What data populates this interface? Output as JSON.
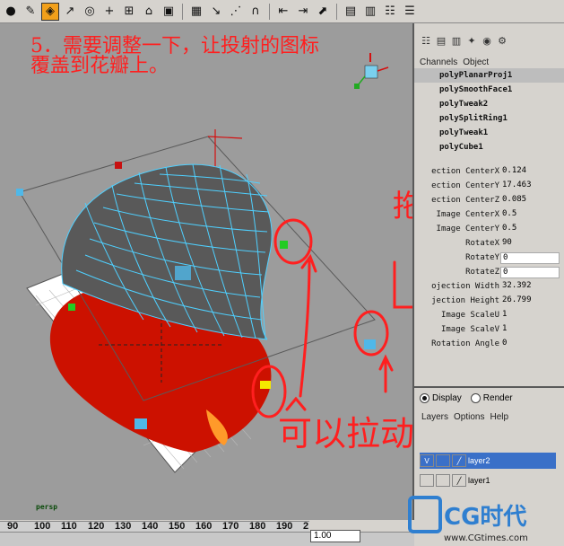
{
  "toolbar": {
    "icons": [
      "select-tool-icon",
      "lasso-tool-icon",
      "paint-select-icon",
      "curve-tool-icon",
      "target-icon",
      "plus-icon",
      "grid-icon",
      "lock-icon",
      "magnet-icon",
      "render-icon",
      "mesh-icon",
      "snap-curve-icon",
      "snap-point-icon",
      "snap-plane-icon",
      "history-icon",
      "frame-icon",
      "ipr-icon",
      "film-icon",
      "channel-box-icon",
      "attribute-editor-icon",
      "tool-settings-icon"
    ]
  },
  "tutorial": {
    "line1": "5．需要调整一下，让投射的图标",
    "line2": "覆盖到花瓣上。"
  },
  "viewport": {
    "camera_label": "persp"
  },
  "annotations": {
    "drag_label": "拖拽！",
    "draggable_label": "可以拉动的"
  },
  "ruler": {
    "ticks": [
      "90",
      "100",
      "110",
      "120",
      "130",
      "140",
      "150",
      "160",
      "170",
      "180",
      "190",
      "2"
    ]
  },
  "timeline": {
    "current_frame": "1.00"
  },
  "panel": {
    "menu": [
      "Channels",
      "Object"
    ],
    "nodes": [
      "polyPlanarProj1",
      "polySmoothFace1",
      "polyTweak2",
      "polySplitRing1",
      "polyTweak1",
      "polyCube1"
    ],
    "attributes": [
      {
        "label": "ection CenterX",
        "value": "0.124"
      },
      {
        "label": "ection CenterY",
        "value": "17.463"
      },
      {
        "label": "ection CenterZ",
        "value": "0.085"
      },
      {
        "label": "Image CenterX",
        "value": "0.5"
      },
      {
        "label": "Image CenterY",
        "value": "0.5"
      },
      {
        "label": "RotateX",
        "value": "90"
      },
      {
        "label": "RotateY",
        "value": "0"
      },
      {
        "label": "RotateZ",
        "value": "0"
      },
      {
        "label": "ojection Width",
        "value": "32.392"
      },
      {
        "label": "jection Height",
        "value": "26.799"
      },
      {
        "label": "Image ScaleU",
        "value": "1"
      },
      {
        "label": "Image ScaleV",
        "value": "1"
      },
      {
        "label": "Rotation Angle",
        "value": "0"
      }
    ]
  },
  "layers": {
    "display_label": "Display",
    "render_label": "Render",
    "menu": [
      "Layers",
      "Options",
      "Help"
    ],
    "rows": [
      {
        "visible": "V",
        "name": "layer2"
      },
      {
        "visible": "",
        "name": "layer1"
      }
    ]
  },
  "watermark": {
    "text": "CG时代",
    "url": "www.CGtimes.com"
  },
  "colors": {
    "annotation": "#ff1f1f",
    "wire": "#4fd0ff",
    "petal": "#cc1100",
    "active_tool": "#f2a01a",
    "layer_selected": "#3a70c8"
  }
}
